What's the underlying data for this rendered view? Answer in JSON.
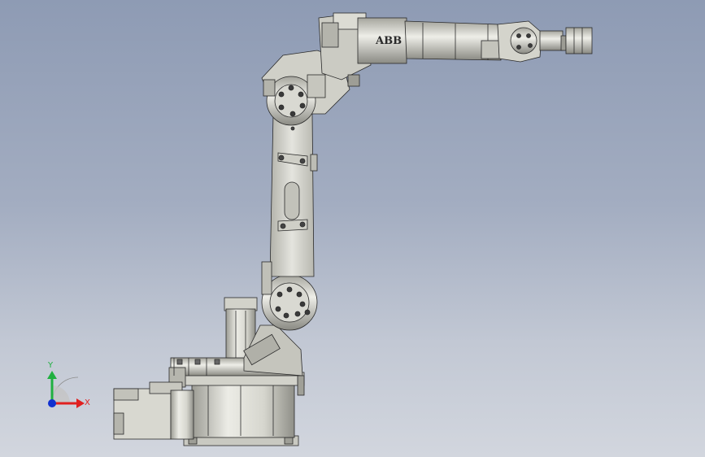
{
  "viewport": {
    "background_top": "#8e9bb4",
    "background_bottom": "#d2d6de"
  },
  "model": {
    "brand_label": "ABB",
    "colors": {
      "body": "#d9d9d2",
      "shade": "#b8b8ae",
      "dark": "#6f6f6a",
      "outline": "#2a2a2a"
    }
  },
  "triad": {
    "x_label": "X",
    "y_label": "Y",
    "x_color": "#e02020",
    "y_color": "#20b040",
    "z_color": "#1030d0"
  }
}
